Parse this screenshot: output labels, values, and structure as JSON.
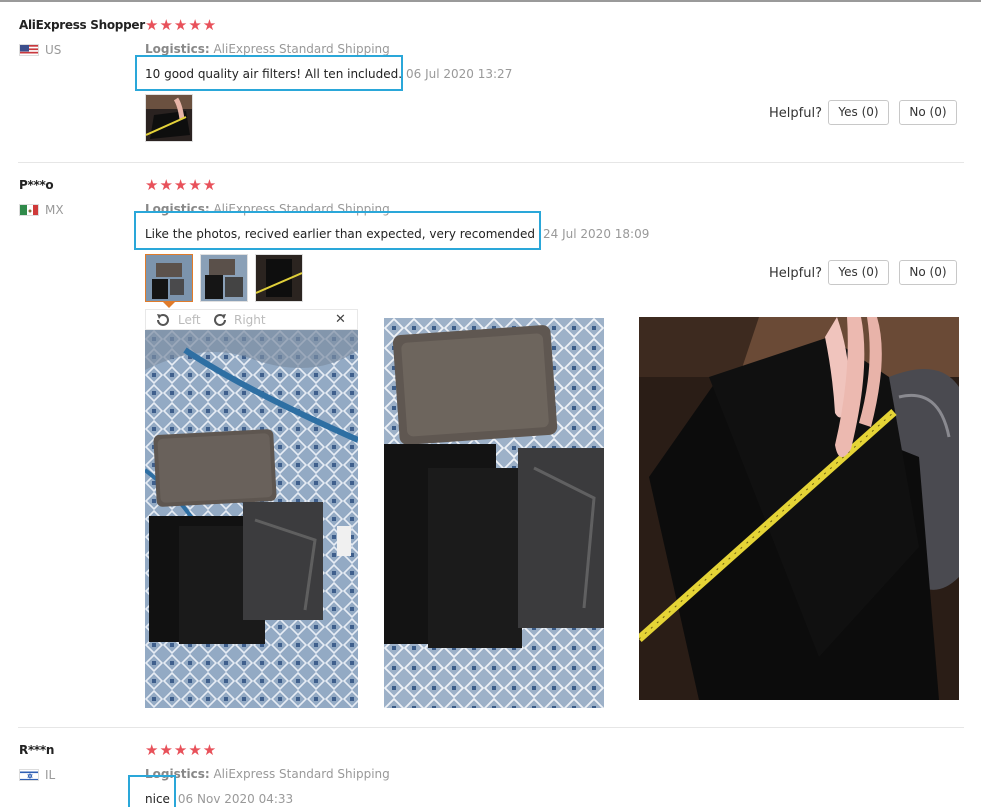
{
  "reviews": [
    {
      "user": "AliExpress Shopper",
      "country": "US",
      "stars": "★★★★★",
      "logistics_label": "Logistics:",
      "logistics_value": "AliExpress Standard Shipping",
      "comment": "10 good quality air filters! All ten included.",
      "date": "06 Jul 2020 13:27",
      "helpful_label": "Helpful?",
      "yes_label": "Yes (0)",
      "no_label": "No (0)"
    },
    {
      "user": "P***o",
      "country": "MX",
      "stars": "★★★★★",
      "logistics_label": "Logistics:",
      "logistics_value": "AliExpress Standard Shipping",
      "comment": "Like the photos, recived earlier than expected, very recomended",
      "date": "24 Jul 2020 18:09",
      "helpful_label": "Helpful?",
      "yes_label": "Yes (0)",
      "no_label": "No (0)",
      "viewer": {
        "rotate_left_label": "Left",
        "rotate_right_label": "Right",
        "close_glyph": "✕"
      }
    },
    {
      "user": "R***n",
      "country": "IL",
      "stars": "★★★★★",
      "logistics_label": "Logistics:",
      "logistics_value": "AliExpress Standard Shipping",
      "comment": "nice",
      "date": "06 Nov 2020 04:33"
    }
  ],
  "colors": {
    "star": "#e8515a",
    "highlight_box": "#2aa7d9",
    "active_thumb": "#e07b2a"
  },
  "icons": {
    "rotate_left": "rotate-left-icon",
    "rotate_right": "rotate-right-icon",
    "close": "close-icon"
  }
}
